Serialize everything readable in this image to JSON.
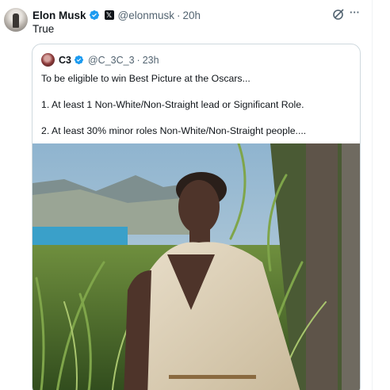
{
  "tweet": {
    "author_name": "Elon Musk",
    "handle": "@elonmusk",
    "separator": "·",
    "time": "20h",
    "text": "True",
    "verified_color": "#1d9bf0"
  },
  "quoted_tweet": {
    "author_name": "C3",
    "handle": "@C_3C_3",
    "separator": "·",
    "time": "23h",
    "lines": [
      "To be eligible to win Best Picture at the Oscars...",
      "1. At least 1 Non-White/Non-Straight lead or Significant Role.",
      "2. At least 30% minor roles Non-White/Non-Straight people...."
    ],
    "verified_color": "#1d9bf0"
  },
  "icons": {
    "grok": "grok-icon",
    "more": "more-icon",
    "org_badge": "x-logo-badge"
  }
}
